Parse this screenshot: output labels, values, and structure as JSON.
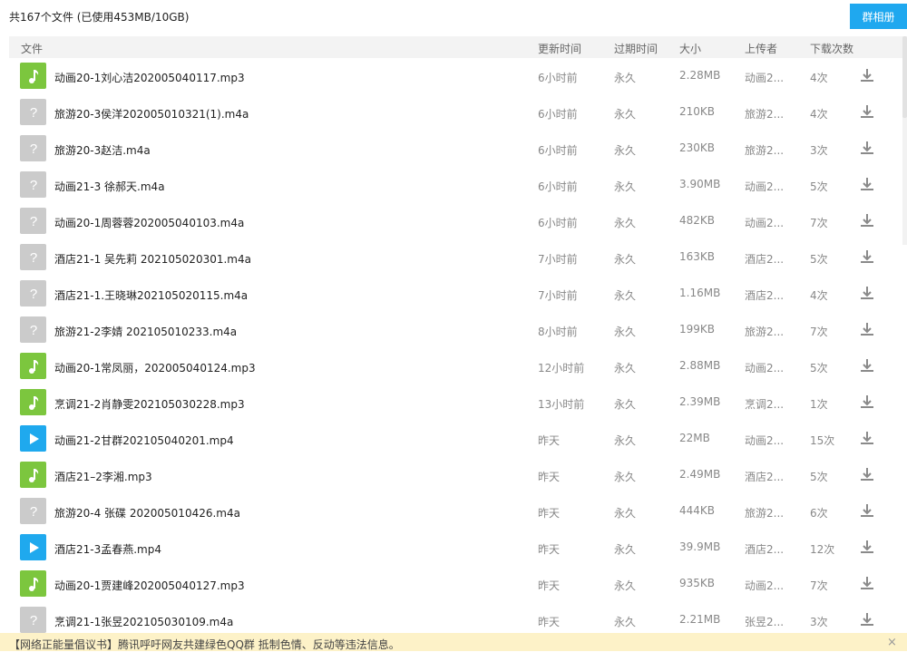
{
  "summary": "共167个文件 (已使用453MB/10GB)",
  "album_button": "群相册",
  "columns": {
    "name": "文件",
    "updated": "更新时间",
    "expiry": "过期时间",
    "size": "大小",
    "uploader": "上传者",
    "downloads": "下载次数"
  },
  "files": [
    {
      "type": "mp3",
      "name": "动画20-1刘心洁202005040117.mp3",
      "updated": "6小时前",
      "expiry": "永久",
      "size": "2.28MB",
      "uploader": "动画2...",
      "downloads": "4次"
    },
    {
      "type": "unknown",
      "name": "旅游20-3侯洋202005010321(1).m4a",
      "updated": "6小时前",
      "expiry": "永久",
      "size": "210KB",
      "uploader": "旅游2...",
      "downloads": "4次"
    },
    {
      "type": "unknown",
      "name": "旅游20-3赵洁.m4a",
      "updated": "6小时前",
      "expiry": "永久",
      "size": "230KB",
      "uploader": "旅游2...",
      "downloads": "3次"
    },
    {
      "type": "unknown",
      "name": "动画21-3 徐郝天.m4a",
      "updated": "6小时前",
      "expiry": "永久",
      "size": "3.90MB",
      "uploader": "动画2...",
      "downloads": "5次"
    },
    {
      "type": "unknown",
      "name": "动画20-1周蓉蓉202005040103.m4a",
      "updated": "6小时前",
      "expiry": "永久",
      "size": "482KB",
      "uploader": "动画2...",
      "downloads": "7次"
    },
    {
      "type": "unknown",
      "name": "酒店21-1 吴先莉 202105020301.m4a",
      "updated": "7小时前",
      "expiry": "永久",
      "size": "163KB",
      "uploader": "酒店2...",
      "downloads": "5次"
    },
    {
      "type": "unknown",
      "name": "酒店21-1.王晓琳202105020115.m4a",
      "updated": "7小时前",
      "expiry": "永久",
      "size": "1.16MB",
      "uploader": "酒店2...",
      "downloads": "4次"
    },
    {
      "type": "unknown",
      "name": "旅游21-2李婧 202105010233.m4a",
      "updated": "8小时前",
      "expiry": "永久",
      "size": "199KB",
      "uploader": "旅游2...",
      "downloads": "7次"
    },
    {
      "type": "mp3",
      "name": "动画20-1常凤丽，202005040124.mp3",
      "updated": "12小时前",
      "expiry": "永久",
      "size": "2.88MB",
      "uploader": "动画2...",
      "downloads": "5次"
    },
    {
      "type": "mp3",
      "name": "烹调21-2肖静雯202105030228.mp3",
      "updated": "13小时前",
      "expiry": "永久",
      "size": "2.39MB",
      "uploader": "烹调2...",
      "downloads": "1次"
    },
    {
      "type": "mp4",
      "name": "动画21-2甘群202105040201.mp4",
      "updated": "昨天",
      "expiry": "永久",
      "size": "22MB",
      "uploader": "动画2...",
      "downloads": "15次"
    },
    {
      "type": "mp3",
      "name": "酒店21–2李湘.mp3",
      "updated": "昨天",
      "expiry": "永久",
      "size": "2.49MB",
      "uploader": "酒店2...",
      "downloads": "5次"
    },
    {
      "type": "unknown",
      "name": "旅游20-4  张碟  202005010426.m4a",
      "updated": "昨天",
      "expiry": "永久",
      "size": "444KB",
      "uploader": "旅游2...",
      "downloads": "6次"
    },
    {
      "type": "mp4",
      "name": "酒店21-3孟春燕.mp4",
      "updated": "昨天",
      "expiry": "永久",
      "size": "39.9MB",
      "uploader": "酒店2...",
      "downloads": "12次"
    },
    {
      "type": "mp3",
      "name": "动画20-1贾建峰202005040127.mp3",
      "updated": "昨天",
      "expiry": "永久",
      "size": "935KB",
      "uploader": "动画2...",
      "downloads": "7次"
    },
    {
      "type": "unknown",
      "name": "烹调21-1张昱202105030109.m4a",
      "updated": "昨天",
      "expiry": "永久",
      "size": "2.21MB",
      "uploader": "张昱2...",
      "downloads": "3次"
    }
  ],
  "notice": "【网络正能量倡议书】腾讯呼吁网友共建绿色QQ群 抵制色情、反动等违法信息。",
  "notice_close": "×",
  "colors": {
    "accent": "#1fa8ef",
    "audio_icon": "#7cc63e",
    "video_icon": "#1fa9ee",
    "unknown_icon": "#cbcbcb",
    "notice_bg": "#fdf2c8"
  }
}
